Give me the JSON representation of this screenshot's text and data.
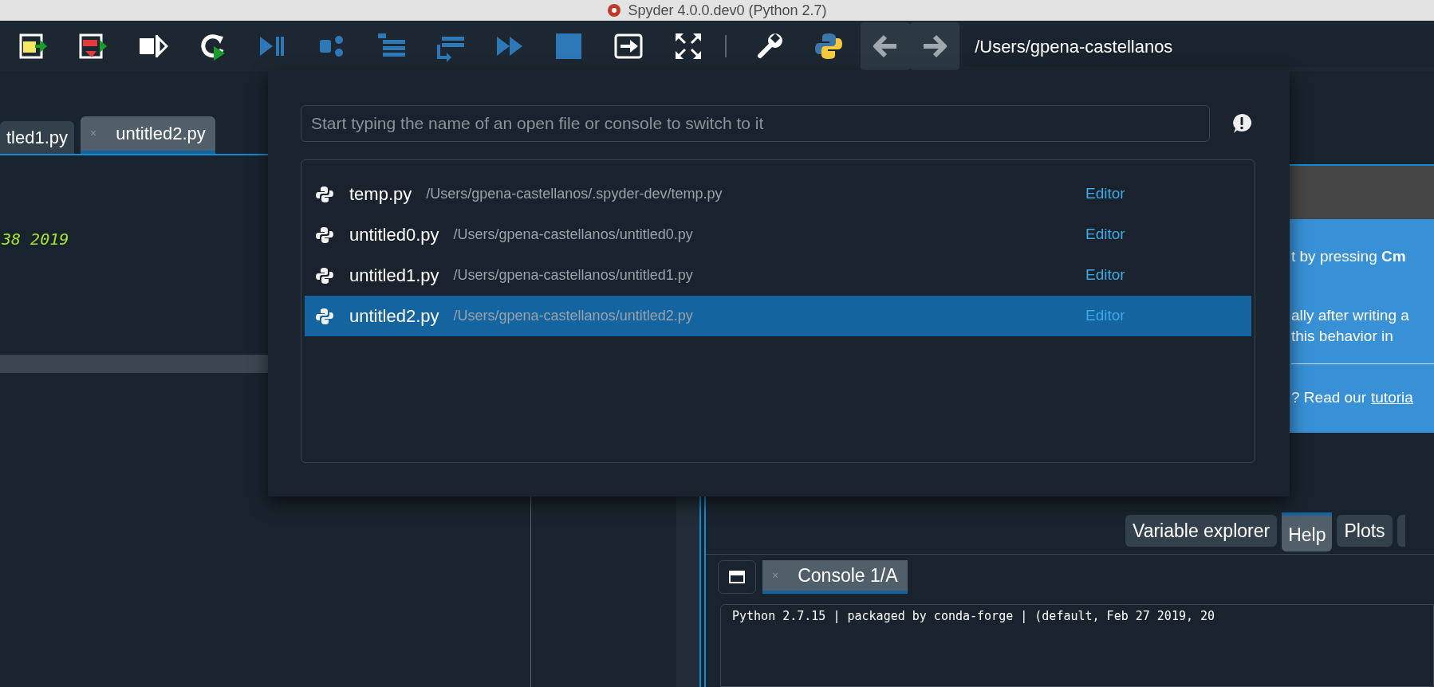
{
  "window": {
    "title": "Spyder 4.0.0.dev0 (Python 2.7)"
  },
  "toolbar": {
    "path": "/Users/gpena-castellanos"
  },
  "editor": {
    "tabs": [
      {
        "label": "tled1.py",
        "selected": false
      },
      {
        "label": "untitled2.py",
        "selected": true,
        "close": "×"
      }
    ],
    "code_fragment": "38 2019"
  },
  "switcher": {
    "placeholder": "Start typing the name of an open file or console to switch to it",
    "items": [
      {
        "name": "temp.py",
        "path": "/Users/gpena-castellanos/.spyder-dev/temp.py",
        "section": "Editor",
        "selected": false
      },
      {
        "name": "untitled0.py",
        "path": "/Users/gpena-castellanos/untitled0.py",
        "section": "Editor",
        "selected": false
      },
      {
        "name": "untitled1.py",
        "path": "/Users/gpena-castellanos/untitled1.py",
        "section": "Editor",
        "selected": false
      },
      {
        "name": "untitled2.py",
        "path": "/Users/gpena-castellanos/untitled2.py",
        "section": "Editor",
        "selected": true
      }
    ]
  },
  "help": {
    "lines": [
      "t by pressing **Cm**",
      "ally after writing a",
      "this behavior in"
    ],
    "footer": "? Read our",
    "footer_link": "tutoria"
  },
  "pane_tabs": [
    {
      "label": "Variable explorer",
      "selected": false
    },
    {
      "label": "Help",
      "selected": true
    },
    {
      "label": "Plots",
      "selected": false
    }
  ],
  "console": {
    "tabs": [
      {
        "label": "Console 1/A",
        "selected": true,
        "close": "×"
      }
    ],
    "banner": "Python 2.7.15 | packaged by conda-forge | (default, Feb 27 2019, 20"
  }
}
